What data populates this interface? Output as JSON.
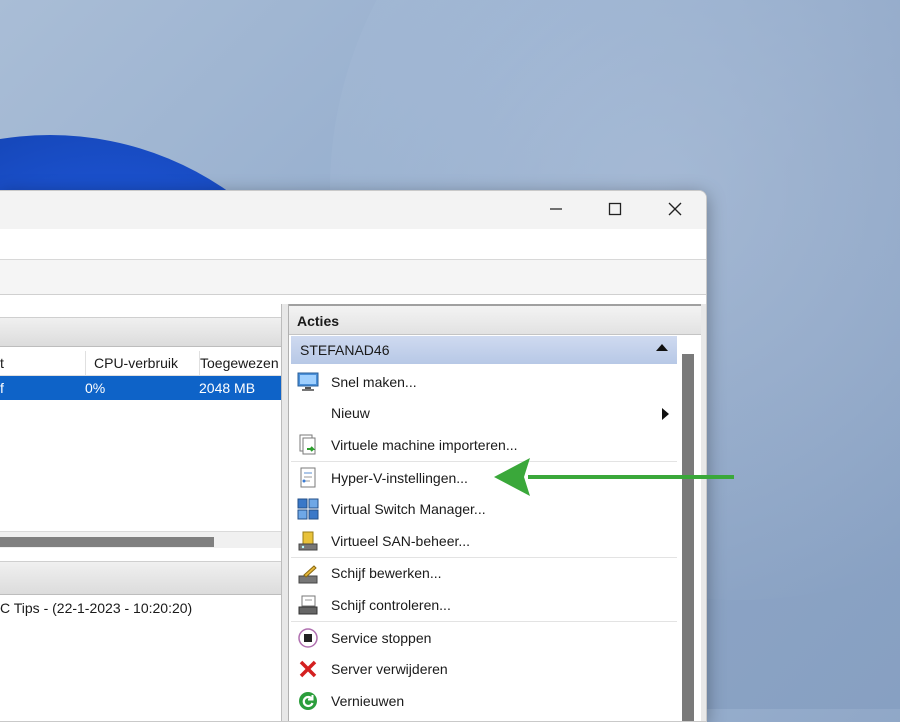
{
  "vm_table": {
    "headers": [
      "t",
      "CPU-verbruik",
      "Toegewezen"
    ],
    "row": [
      "f",
      "0%",
      "2048 MB"
    ]
  },
  "log_entry": "C Tips - (22-1-2023 - 10:20:20)",
  "actions_panel": {
    "title": "Acties",
    "host": "STEFANAD46",
    "items": [
      {
        "label": "Snel maken...",
        "icon": "monitor-icon"
      },
      {
        "label": "Nieuw",
        "icon": "none"
      },
      {
        "label": "Virtuele machine importeren...",
        "icon": "import-icon"
      },
      {
        "label": "Hyper-V-instellingen...",
        "icon": "settings-document-icon"
      },
      {
        "label": "Virtual Switch Manager...",
        "icon": "network-switch-icon"
      },
      {
        "label": "Virtueel SAN-beheer...",
        "icon": "san-icon"
      },
      {
        "label": "Schijf bewerken...",
        "icon": "disk-edit-icon"
      },
      {
        "label": "Schijf controleren...",
        "icon": "disk-inspect-icon"
      },
      {
        "label": "Service stoppen",
        "icon": "stop-icon"
      },
      {
        "label": "Server verwijderen",
        "icon": "red-x-icon"
      },
      {
        "label": "Vernieuwen",
        "icon": "refresh-icon"
      }
    ]
  },
  "colors": {
    "selection": "#0e63c8",
    "annotation_arrow": "#3aa83a",
    "host_bar": "#c3d2ec"
  }
}
